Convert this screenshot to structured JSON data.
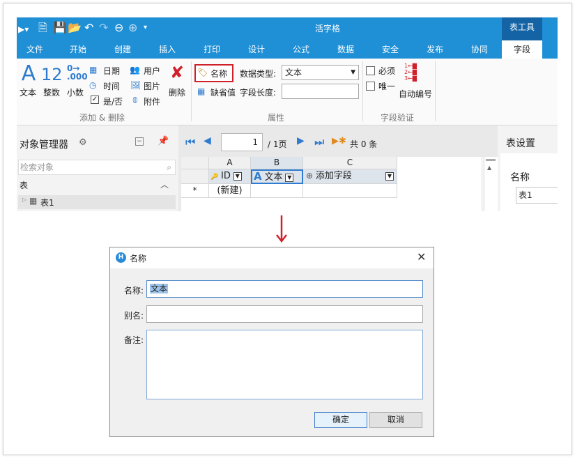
{
  "app": {
    "title": "活字格",
    "context_tab": "表工具",
    "tabs": [
      "文件",
      "开始",
      "创建",
      "插入",
      "打印",
      "设计",
      "公式",
      "数据",
      "安全",
      "发布",
      "协同",
      "字段"
    ],
    "active_tab": "字段"
  },
  "ribbon": {
    "add_delete": {
      "text_label": "文本",
      "integer_label": "整数",
      "decimal_label": "小数",
      "date_label": "日期",
      "time_label": "时间",
      "yesno_label": "是/否",
      "user_label": "用户",
      "image_label": "图片",
      "attachment_label": "附件",
      "delete_label": "删除",
      "group_label": "添加 & 删除"
    },
    "properties": {
      "name_label": "名称",
      "default_label": "缺省值",
      "datatype_label": "数据类型:",
      "datatype_value": "文本",
      "length_label": "字段长度:",
      "group_label": "属性"
    },
    "validation": {
      "required_label": "必须",
      "unique_label": "唯一",
      "auto_number_label": "自动编号",
      "group_label": "字段验证"
    }
  },
  "object_manager": {
    "title": "对象管理器",
    "search_placeholder": "检索对象",
    "section": "表",
    "items": [
      "表1"
    ]
  },
  "navigator": {
    "page_input": "1",
    "page_suffix": "/ 1页",
    "total": "共 0 条"
  },
  "grid": {
    "columns": [
      "A",
      "B",
      "C"
    ],
    "fields": [
      "ID",
      "文本",
      "添加字段"
    ],
    "row_marker": "*",
    "new_row": "(新建)"
  },
  "table_settings": {
    "title": "表设置",
    "name_label": "名称",
    "name_value": "表1"
  },
  "dialog": {
    "title": "名称",
    "name_label": "名称:",
    "name_value": "文本",
    "alias_label": "别名:",
    "alias_value": "",
    "note_label": "备注:",
    "note_value": "",
    "ok_label": "确定",
    "cancel_label": "取消"
  },
  "colors": {
    "brand": "#1f8fd6",
    "context_tab": "#1464a5",
    "highlight_box": "#d0202a",
    "arrow": "#d0202a"
  }
}
